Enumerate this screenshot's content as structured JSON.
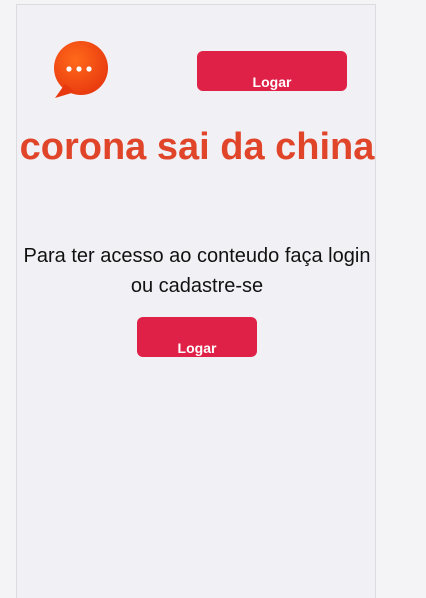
{
  "header": {
    "logo_icon": "chat-bubble-icon",
    "login_label": "Logar"
  },
  "main": {
    "title": "corona sai da china",
    "subtitle": "Para ter acesso ao conteudo faça login ou cadastre-se",
    "login_label": "Logar"
  },
  "colors": {
    "accent": "#e02147",
    "title": "#e0452a",
    "background": "#f1f0f5"
  }
}
